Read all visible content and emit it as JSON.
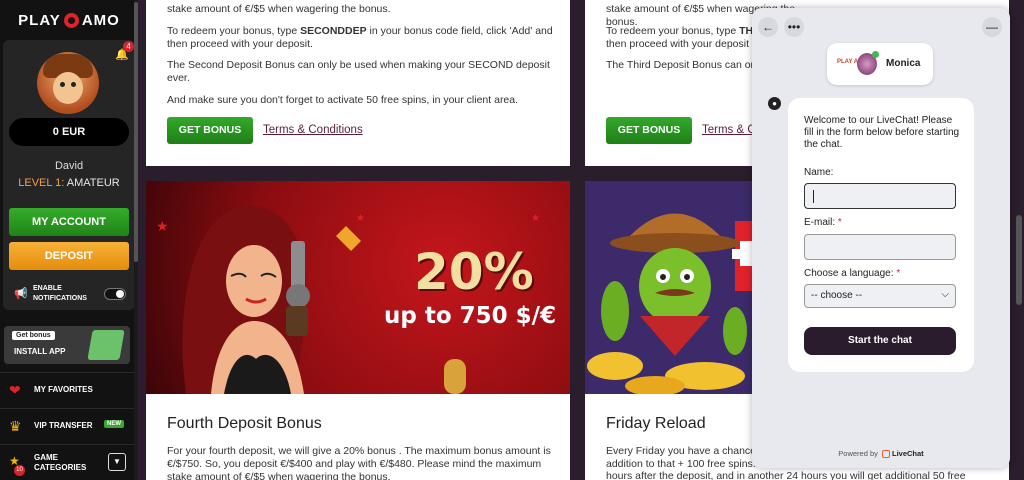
{
  "sidebar": {
    "logo_left": "PLAY",
    "logo_right": "AMO",
    "notifications_count": "4",
    "balance": "0 EUR",
    "username": "David",
    "level_prefix": "LEVEL 1:",
    "level_name": "AMATEUR",
    "my_account": "MY ACCOUNT",
    "deposit": "DEPOSIT",
    "notif_line1": "ENABLE",
    "notif_line2": "NOTIFICATIONS",
    "get_bonus_tag": "Get bonus",
    "install_app": "INSTALL APP",
    "items": [
      {
        "label": "MY FAVORITES",
        "icon": "heart-icon"
      },
      {
        "label": "VIP TRANSFER",
        "icon": "crown-icon",
        "badge": "NEW"
      },
      {
        "label_line1": "GAME",
        "label_line2": "CATEGORIES",
        "icon": "slot-icon",
        "badge": "10"
      }
    ]
  },
  "card1": {
    "partial_top": "stake amount of €/$5 when wagering the bonus.",
    "p1_before": "To redeem your bonus, type ",
    "p1_code": "SECONDDEP",
    "p1_after": " in your bonus code field, click 'Add' and then proceed with your deposit.",
    "p2": "The Second Deposit Bonus can only be used when making your SECOND deposit ever.",
    "p3": "And make sure you don't forget to activate 50 free spins, in your client area.",
    "button": "GET BONUS",
    "terms": "Terms & Conditions"
  },
  "card2": {
    "partial_top": "stake amount of €/$5 when wagering the bonus.",
    "p1_before": "To redeem your bonus, type ",
    "p1_code": "TH",
    "p1_line2": "then proceed with your deposit",
    "p2": "The Third Deposit Bonus can on",
    "button": "GET BONUS",
    "terms": "Terms & C"
  },
  "banner1": {
    "percent": "20%",
    "sub": "up to 750 $/€"
  },
  "card3": {
    "title": "Fourth Deposit Bonus",
    "text": "For your fourth deposit, we will give a 20% bonus . The maximum bonus amount is €/$750. So, you deposit €/$400 and play with €/$480. Please mind the maximum stake amount of €/$5 when wagering the bonus."
  },
  "card4": {
    "title": "Friday Reload",
    "line1": "Every Friday you have a chance",
    "line2": "addition to that + 100 free spins.",
    "line3": "hours after the deposit, and in another 24 hours you will get additional 50 free"
  },
  "chat": {
    "agent_name": "Monica",
    "agent_logo": "PLAY AMO",
    "welcome": "Welcome to our LiveChat! Please fill in the form below before starting the chat.",
    "name_label": "Name:",
    "email_label": "E-mail:",
    "lang_label": "Choose a language:",
    "required_mark": "*",
    "lang_value": "-- choose --",
    "start_button": "Start the chat",
    "powered_by": "Powered by",
    "powered_brand": "LiveChat"
  },
  "colors": {
    "green_button": "#2a9a21",
    "deposit_orange": "#f0a021",
    "chat_dark": "#2a1b2d",
    "accent_red": "#e0222a"
  }
}
